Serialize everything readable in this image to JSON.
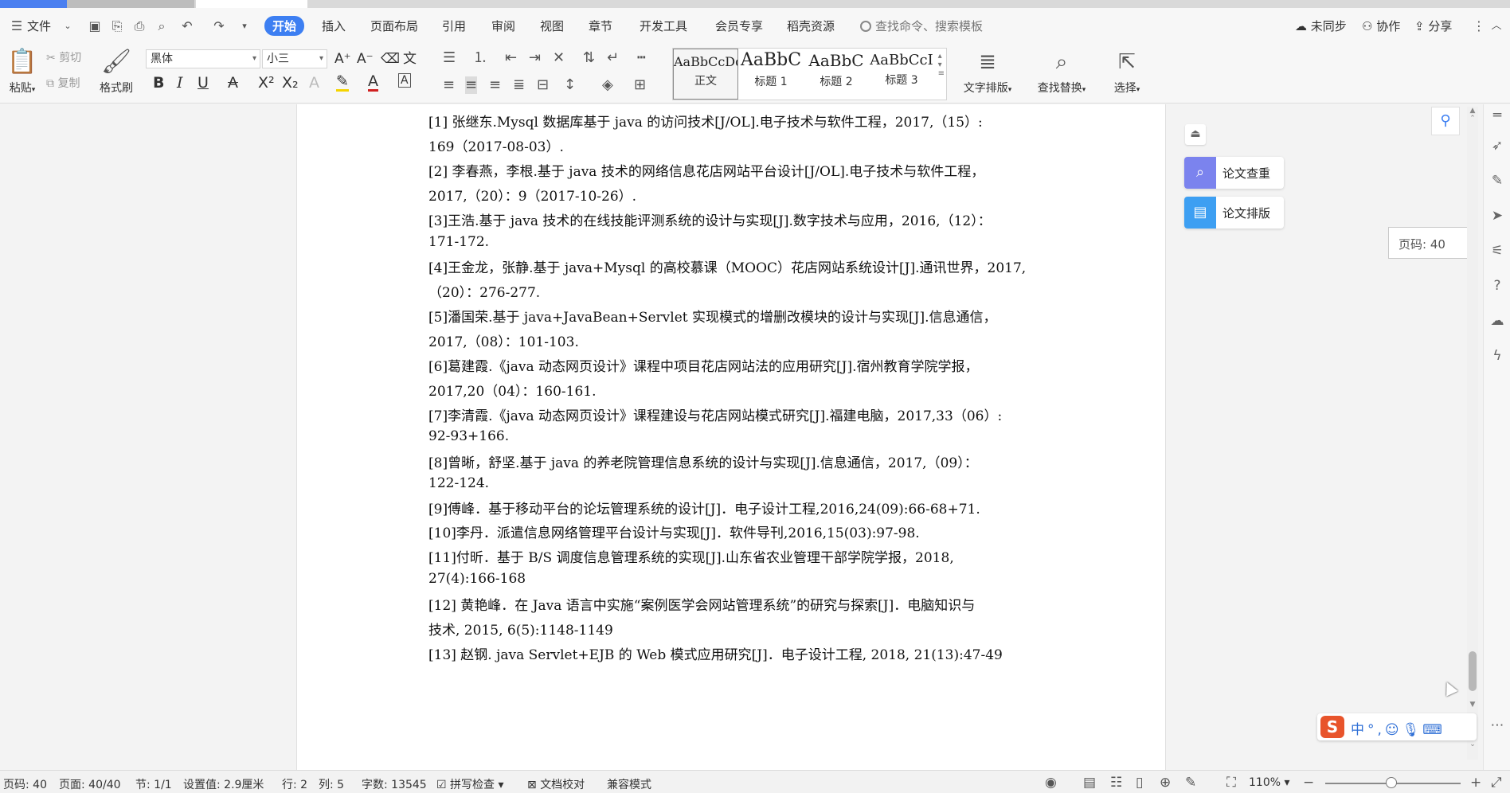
{
  "menubar": {
    "file": "文件",
    "tabs": [
      "开始",
      "插入",
      "页面布局",
      "引用",
      "审阅",
      "视图",
      "章节",
      "开发工具",
      "会员专享",
      "稻壳资源"
    ],
    "search_placeholder": "查找命令、搜索模板",
    "sync": "未同步",
    "collab": "协作",
    "share": "分享"
  },
  "ribbon": {
    "paste": "粘贴",
    "cut": "剪切",
    "copy": "复制",
    "format_painter": "格式刷",
    "font_name": "黑体",
    "font_size": "小三",
    "styles": [
      {
        "sample": "AaBbCcDd",
        "name": "正文"
      },
      {
        "sample": "AaBbC",
        "name": "标题 1"
      },
      {
        "sample": "AaBbC",
        "name": "标题 2"
      },
      {
        "sample": "AaBbCcI",
        "name": "标题 3"
      }
    ],
    "text_layout": "文字排版",
    "find_replace": "查找替换",
    "select": "选择"
  },
  "document": {
    "lines": [
      "[1]  张继东.Mysql 数据库基于 java 的访问技术[J/OL].电子技术与软件工程，2017,（15）:",
      "169（2017-08-03）.",
      "[2]  李春燕，李根.基于 java 技术的网络信息花店网站平台设计[J/OL].电子技术与软件工程，",
      "2017,（20）：9（2017-10-26）.",
      "[3]王浩.基于 java 技术的在线技能评测系统的设计与实现[J].数字技术与应用，2016,（12）：",
      "171-172.",
      "[4]王金龙，张静.基于 java+Mysql 的高校慕课（MOOC）花店网站系统设计[J].通讯世界，2017,",
      "（20）：276-277.",
      "[5]潘国荣.基于 java+JavaBean+Servlet 实现模式的增删改模块的设计与实现[J].信息通信，",
      "2017,（08）：101-103.",
      "[6]葛建霞.《java 动态网页设计》课程中项目花店网站法的应用研究[J].宿州教育学院学报，",
      "2017,20（04）：160-161.",
      "[7]李清霞.《java 动态网页设计》课程建设与花店网站模式研究[J].福建电脑，2017,33（06）:",
      "92-93+166.",
      "[8]曾晰，舒坚.基于 java 的养老院管理信息系统的设计与实现[J].信息通信，2017,（09）：",
      "122-124.",
      "[9]傅峰．基于移动平台的论坛管理系统的设计[J]．电子设计工程,2016,24(09):66-68+71.",
      "[10]李丹．派遣信息网络管理平台设计与实现[J]．软件导刊,2016,15(03):97-98.",
      "[11]付昕．基于 B/S 调度信息管理系统的实现[J].山东省农业管理干部学院学报，2018,",
      "27(4):166-168",
      "[12]  黄艳峰．在 Java 语言中实施“案例医学会网站管理系统”的研究与探索[J]．电脑知识与",
      "技术, 2015, 6(5):1148-1149",
      "[13]  赵钢. java Servlet+EJB 的 Web 模式应用研究[J]．电子设计工程, 2018, 21(13):47-49"
    ]
  },
  "side_panel": {
    "plagiarism_check": "论文查重",
    "thesis_format": "论文排版",
    "page_tip": "页码: 40"
  },
  "ime": {
    "text": "中°,☺🎙⌨"
  },
  "statusbar": {
    "page_no": "页码: 40",
    "page": "页面: 40/40",
    "section": "节: 1/1",
    "setting": "设置值: 2.9厘米",
    "row": "行: 2",
    "col": "列: 5",
    "word_count": "字数: 13545",
    "spell_check": "拼写检查",
    "doc_proof": "文档校对",
    "compat_mode": "兼容模式",
    "zoom": "110%"
  },
  "colors": {
    "accent": "#3d7ff2",
    "brand_orange": "#e8542b"
  }
}
